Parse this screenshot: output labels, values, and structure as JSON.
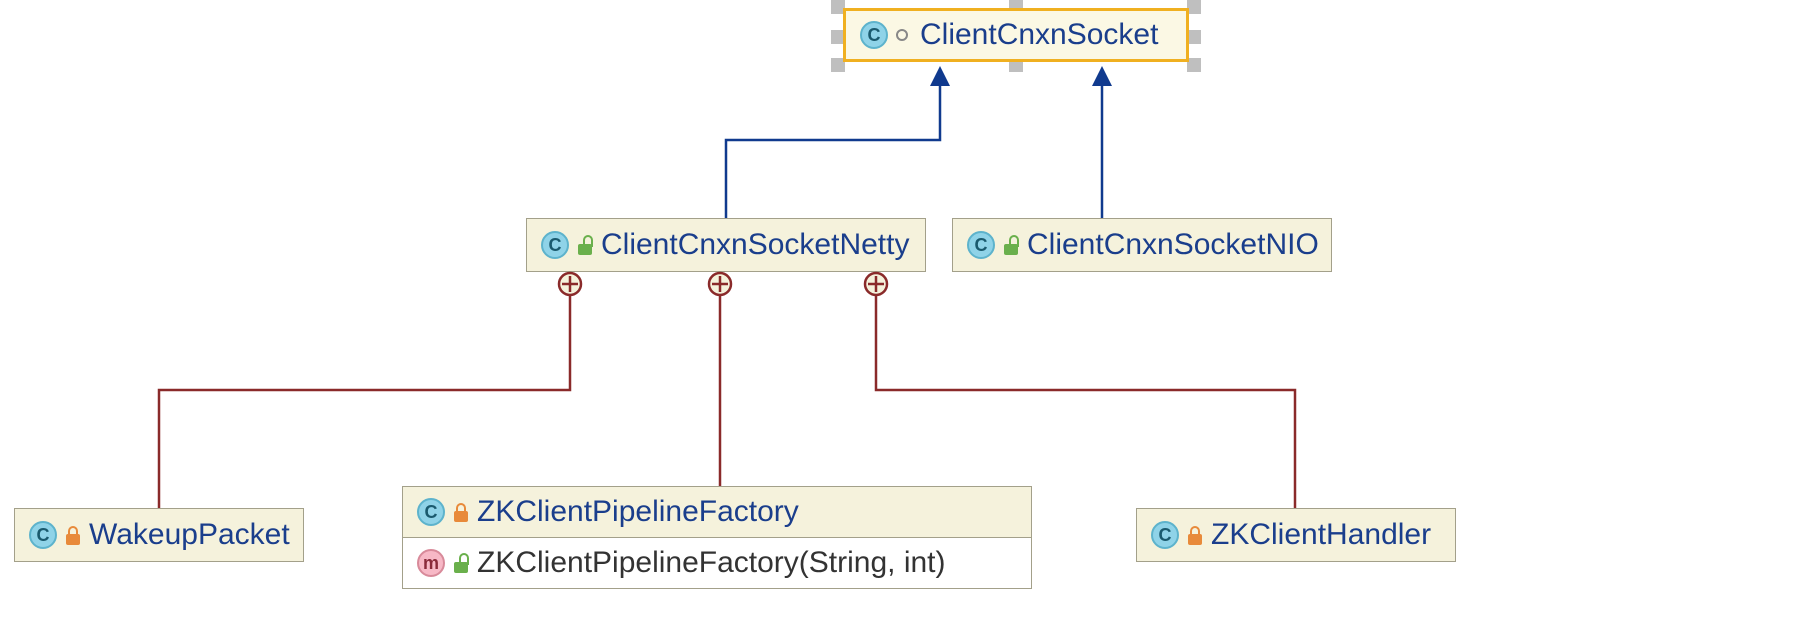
{
  "nodes": {
    "clientCnxnSocket": {
      "label": "ClientCnxnSocket",
      "kind_letter": "C"
    },
    "clientCnxnSocketNetty": {
      "label": "ClientCnxnSocketNetty",
      "kind_letter": "C"
    },
    "clientCnxnSocketNIO": {
      "label": "ClientCnxnSocketNIO",
      "kind_letter": "C"
    },
    "wakeupPacket": {
      "label": "WakeupPacket",
      "kind_letter": "C"
    },
    "zkClientPipelineFactory": {
      "header_label": "ZKClientPipelineFactory",
      "header_kind_letter": "C",
      "method_label": "ZKClientPipelineFactory(String, int)",
      "method_kind_letter": "m"
    },
    "zkClientHandler": {
      "label": "ZKClientHandler",
      "kind_letter": "C"
    }
  },
  "colors": {
    "inheritance_line": "#103a8e",
    "inheritance_fill": "#103a8e",
    "nested_line": "#8a2a2a"
  }
}
